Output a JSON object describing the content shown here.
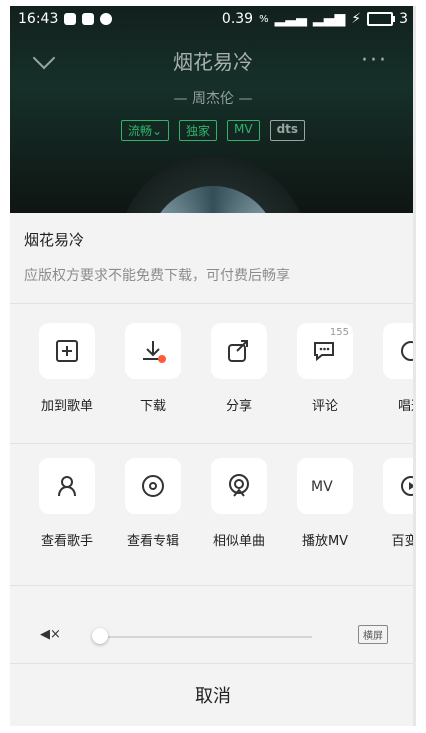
{
  "status": {
    "time": "16:43",
    "speed": "0.39",
    "battery_level": "3"
  },
  "player": {
    "title": "烟花易冷",
    "singer": "周杰伦",
    "tags": [
      "流畅",
      "独家",
      "MV",
      "dts"
    ],
    "more": "···"
  },
  "sheet": {
    "song_title": "烟花易冷",
    "notice": "应版权方要求不能免费下载，可付费后畅享",
    "row1": [
      {
        "label": "加到歌单",
        "icon": "add-to-playlist-icon"
      },
      {
        "label": "下载",
        "icon": "download-icon"
      },
      {
        "label": "分享",
        "icon": "share-icon"
      },
      {
        "label": "评论",
        "icon": "comment-icon",
        "count": "155"
      },
      {
        "label": "唱这",
        "icon": "sing-icon"
      }
    ],
    "row2": [
      {
        "label": "查看歌手",
        "icon": "singer-icon"
      },
      {
        "label": "查看专辑",
        "icon": "album-icon"
      },
      {
        "label": "相似单曲",
        "icon": "similar-songs-icon"
      },
      {
        "label": "播放MV",
        "icon": "mv-icon"
      },
      {
        "label": "百变播",
        "icon": "variety-play-icon"
      }
    ],
    "volume": {
      "level": 0,
      "landscape_label": "横屏"
    },
    "cancel_label": "取消"
  }
}
